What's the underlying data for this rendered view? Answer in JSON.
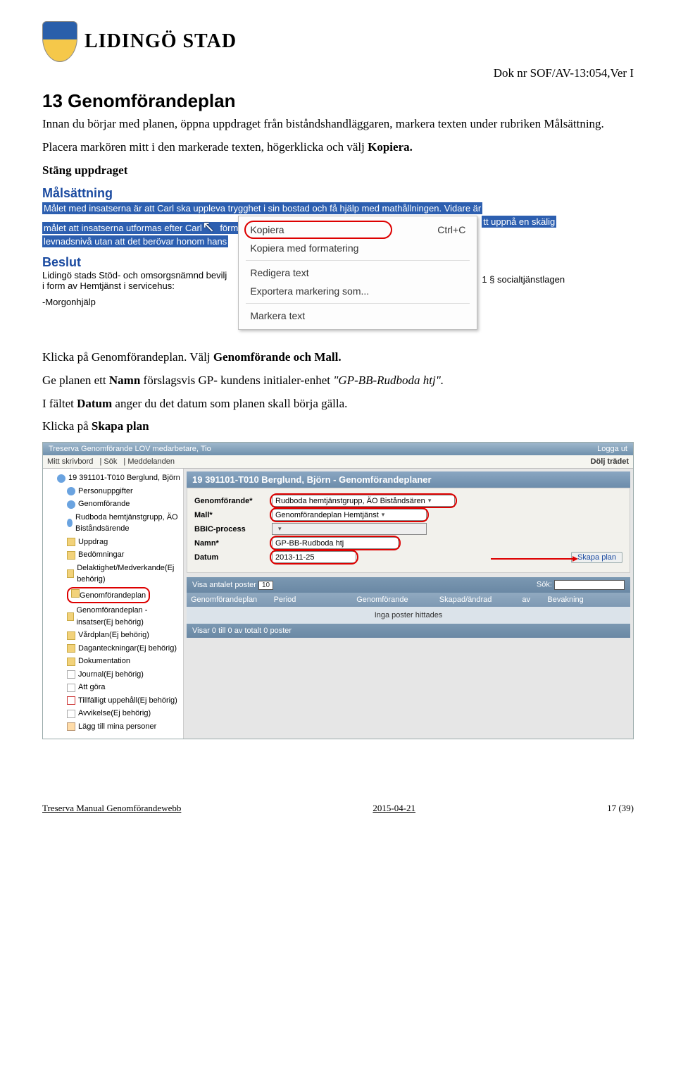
{
  "header": {
    "brand": "LIDINGÖ STAD",
    "docnr": "Dok nr SOF/AV-13:054,Ver I"
  },
  "section": {
    "title": "13 Genomförandeplan",
    "para1_a": "Innan du börjar med planen, öppna uppdraget från biståndshandläggaren, markera texten under rubriken ",
    "para1_b": "Målsättning.",
    "para2_a": "Placera markören mitt i den markerade texten, högerklicka och välj ",
    "para2_b": "Kopiera.",
    "stang": "Stäng uppdraget"
  },
  "shot1": {
    "malsattning_label": "Målsättning",
    "hl_line1": "Målet med insatserna är att Carl ska uppleva trygghet i sin bostad och få hjälp med mathållningen. Vidare är",
    "hl_line2_a": "målet att insatserna utformas efter Carl",
    "hl_line2_b": " förm",
    "hl_after_menu": "tt uppnå en skälig",
    "hl_line3": "levnadsnivå utan att det berövar honom hans",
    "menu": {
      "kopiera": "Kopiera",
      "kopiera_shortcut": "Ctrl+C",
      "kopiera_fmt": "Kopiera med formatering",
      "redigera": "Redigera text",
      "exportera": "Exportera markering som...",
      "markera": "Markera text"
    },
    "beslut_label": "Beslut",
    "beslut_text_a": "Lidingö stads Stöd- och omsorgsnämnd bevilj",
    "beslut_text_b": "1 § socialtjänstlagen",
    "beslut_text_c": "i form av Hemtjänst i servicehus:",
    "morgon": "-Morgonhjälp"
  },
  "mid": {
    "p1": "Klicka på Genomförandeplan. Välj ",
    "p1b": "Genomförande och Mall.",
    "p2a": "Ge planen ett ",
    "p2b": "Namn",
    "p2c": " förslagsvis GP- kundens initialer-enhet ",
    "p2d": "\"GP-BB-Rudboda htj\".",
    "p3a": "I fältet ",
    "p3b": "Datum",
    "p3c": " anger du det datum som planen skall börja gälla.",
    "p4": "Klicka på ",
    "p4b": "Skapa plan"
  },
  "shot2": {
    "topbar_left": "Treserva Genomförande LOV medarbetare, Tio",
    "topbar_right": "Logga ut",
    "menubar": {
      "skrivbord": "Mitt skrivbord",
      "sok": "Sök",
      "medd": "Meddelanden",
      "dolj": "Dölj trädet"
    },
    "tree": [
      {
        "cls": "indent1",
        "icon": "ic-person",
        "label": "19 391101-T010 Berglund, Björn"
      },
      {
        "cls": "indent2",
        "icon": "ic-person",
        "label": "Personuppgifter"
      },
      {
        "cls": "indent2",
        "icon": "ic-person",
        "label": "Genomförande"
      },
      {
        "cls": "indent2",
        "icon": "ic-person",
        "label": "Rudboda hemtjänstgrupp, ÄO Biståndsärende",
        "sub": true
      },
      {
        "cls": "indent2",
        "icon": "ic-folder",
        "label": "Uppdrag"
      },
      {
        "cls": "indent2",
        "icon": "ic-folder",
        "label": "Bedömningar"
      },
      {
        "cls": "indent2",
        "icon": "ic-folder",
        "label": "Delaktighet/Medverkande(Ej behörig)"
      },
      {
        "cls": "indent2",
        "icon": "ic-folder",
        "label": "Genomförandeplan",
        "circled": true
      },
      {
        "cls": "indent2",
        "icon": "ic-folder",
        "label": "Genomförandeplan - insatser(Ej behörig)"
      },
      {
        "cls": "indent2",
        "icon": "ic-folder",
        "label": "Vårdplan(Ej behörig)"
      },
      {
        "cls": "indent2",
        "icon": "ic-folder",
        "label": "Daganteckningar(Ej behörig)"
      },
      {
        "cls": "indent2",
        "icon": "ic-folder",
        "label": "Dokumentation"
      },
      {
        "cls": "indent2",
        "icon": "ic-page",
        "label": "Journal(Ej behörig)"
      },
      {
        "cls": "indent2",
        "icon": "ic-page",
        "label": "Att göra"
      },
      {
        "cls": "indent2",
        "icon": "ic-cal",
        "label": "Tillfälligt uppehåll(Ej behörig)"
      },
      {
        "cls": "indent2",
        "icon": "ic-page",
        "label": "Avvikelse(Ej behörig)"
      },
      {
        "cls": "indent2",
        "icon": "ic-add",
        "label": "Lägg till mina personer"
      }
    ],
    "panel_title": "19 391101-T010 Berglund, Björn - Genomförandeplaner",
    "form": {
      "genomforande_label": "Genomförande*",
      "genomforande_value": "Rudboda hemtjänstgrupp, ÄO Biståndsären",
      "mall_label": "Mall*",
      "mall_value": "Genomförandeplan Hemtjänst",
      "bbic_label": "BBIC-process",
      "bbic_value": "",
      "namn_label": "Namn*",
      "namn_value": "GP-BB-Rudboda htj",
      "datum_label": "Datum",
      "datum_value": "2013-11-25",
      "skapa": "Skapa plan"
    },
    "grid": {
      "visa": "Visa antalet poster",
      "visa_value": "10",
      "sok": "Sök:",
      "col1": "Genomförandeplan",
      "col2": "Period",
      "col3": "Genomförande",
      "col4": "Skapad/ändrad",
      "col5": "av",
      "col6": "Bevakning",
      "empty": "Inga poster hittades",
      "foot": "Visar 0 till 0 av totalt 0 poster"
    }
  },
  "footer": {
    "left": "Treserva Manual Genomförandewebb",
    "mid": "2015-04-21",
    "right": "17 (39)"
  }
}
